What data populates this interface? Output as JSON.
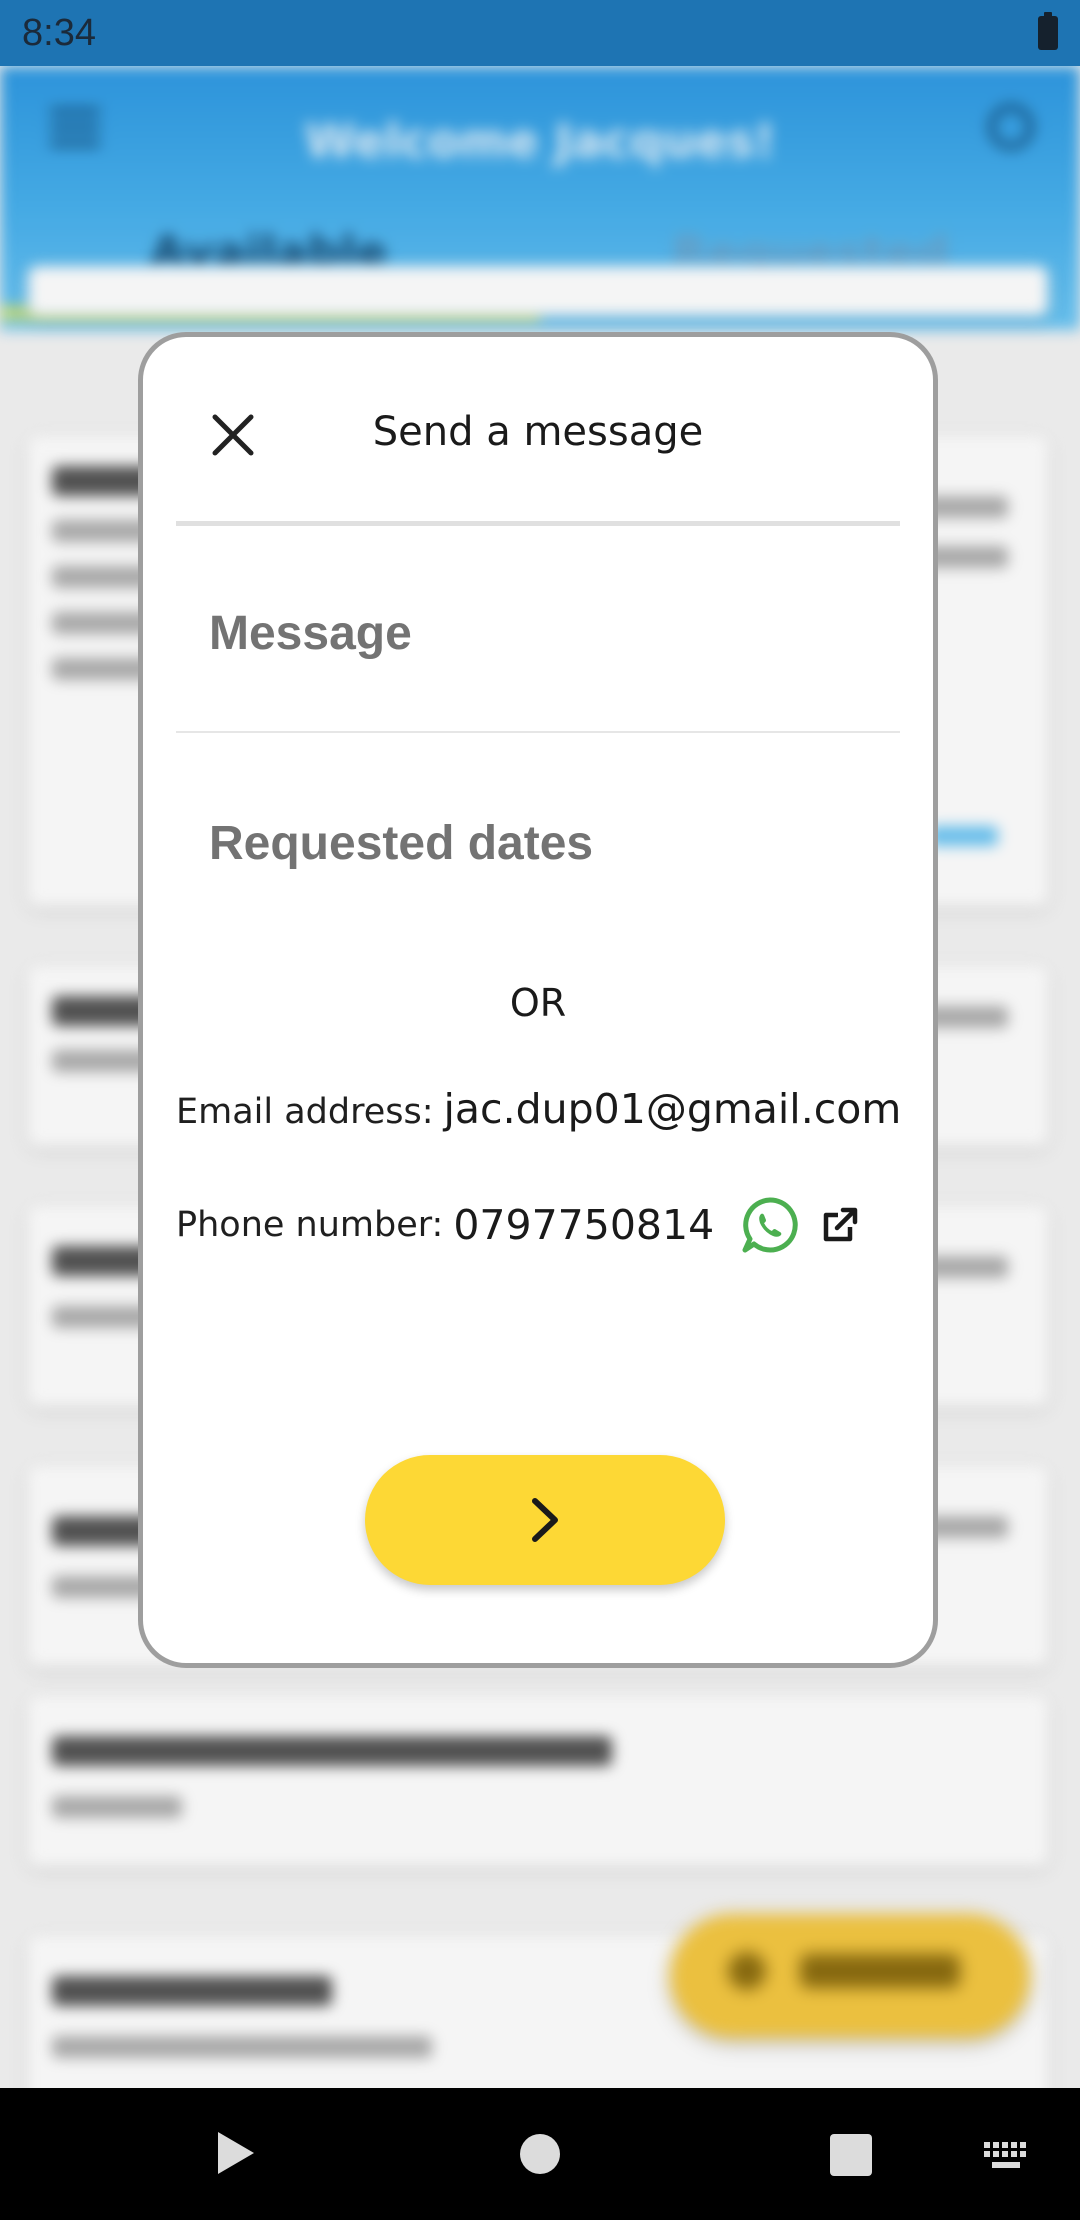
{
  "status_bar": {
    "time": "8:34"
  },
  "app": {
    "title": "Welcome Jacques!",
    "tabs": [
      "Available",
      "Requested"
    ]
  },
  "dialog": {
    "title": "Send a message",
    "message_placeholder": "Message",
    "dates_placeholder": "Requested dates",
    "or_text": "OR",
    "email_label": "Email address:",
    "email_value": "jac.dup01@gmail.com",
    "phone_label": "Phone number:",
    "phone_value": "0797750814"
  },
  "colors": {
    "app_bar": "#2f9ae3",
    "primary_button": "#fdd835",
    "whatsapp": "#4caf50",
    "dialog_border": "#9e9e9e"
  }
}
